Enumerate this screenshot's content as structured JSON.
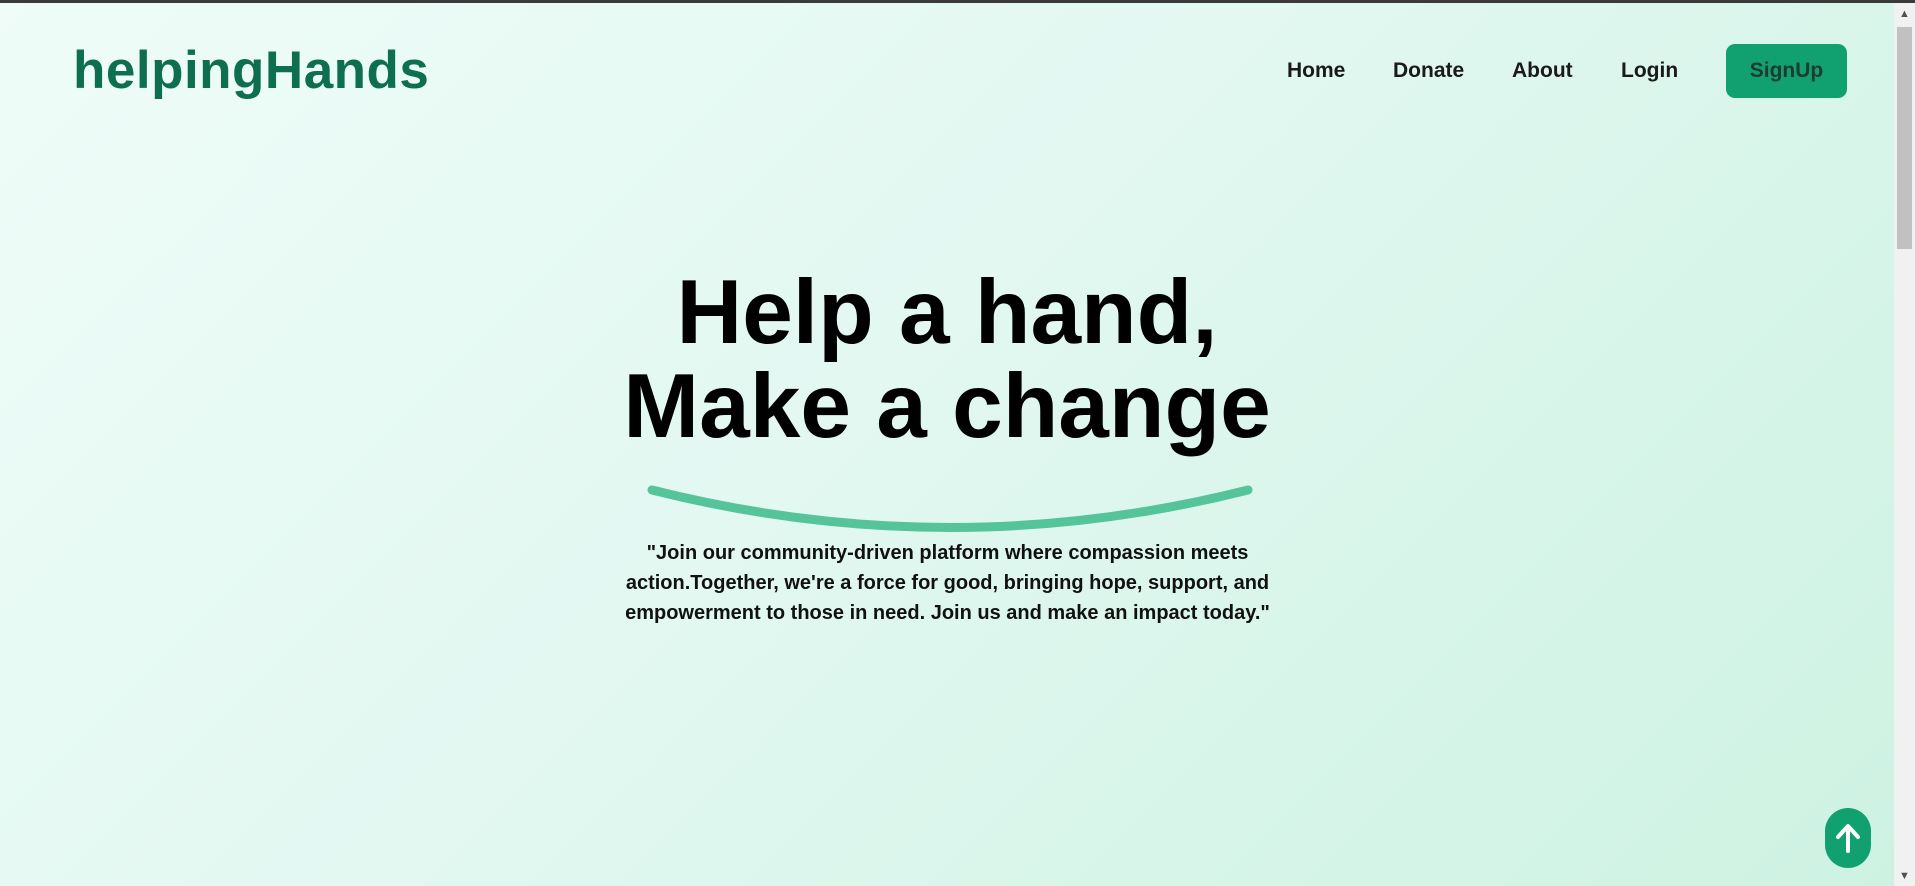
{
  "brand": {
    "name": "helpingHands",
    "color": "#0e6e50"
  },
  "nav": {
    "items": [
      {
        "label": "Home"
      },
      {
        "label": "Donate"
      },
      {
        "label": "About"
      },
      {
        "label": "Login"
      }
    ],
    "signup_label": "SignUp"
  },
  "hero": {
    "title_line1": "Help a hand,",
    "title_line2": "Make a change",
    "quote": "\"Join our community-driven platform where compassion meets action.Together, we're a force for good, bringing hope, support, and empowerment to those in need. Join us and make an impact today.\""
  },
  "icons": {
    "back_to_top": "arrow-up-icon",
    "hero_underline": "curve-underline"
  },
  "colors": {
    "accent": "#11a170",
    "curve": "#56c49a",
    "background_start": "#effcf8",
    "background_end": "#cdf2e2"
  }
}
